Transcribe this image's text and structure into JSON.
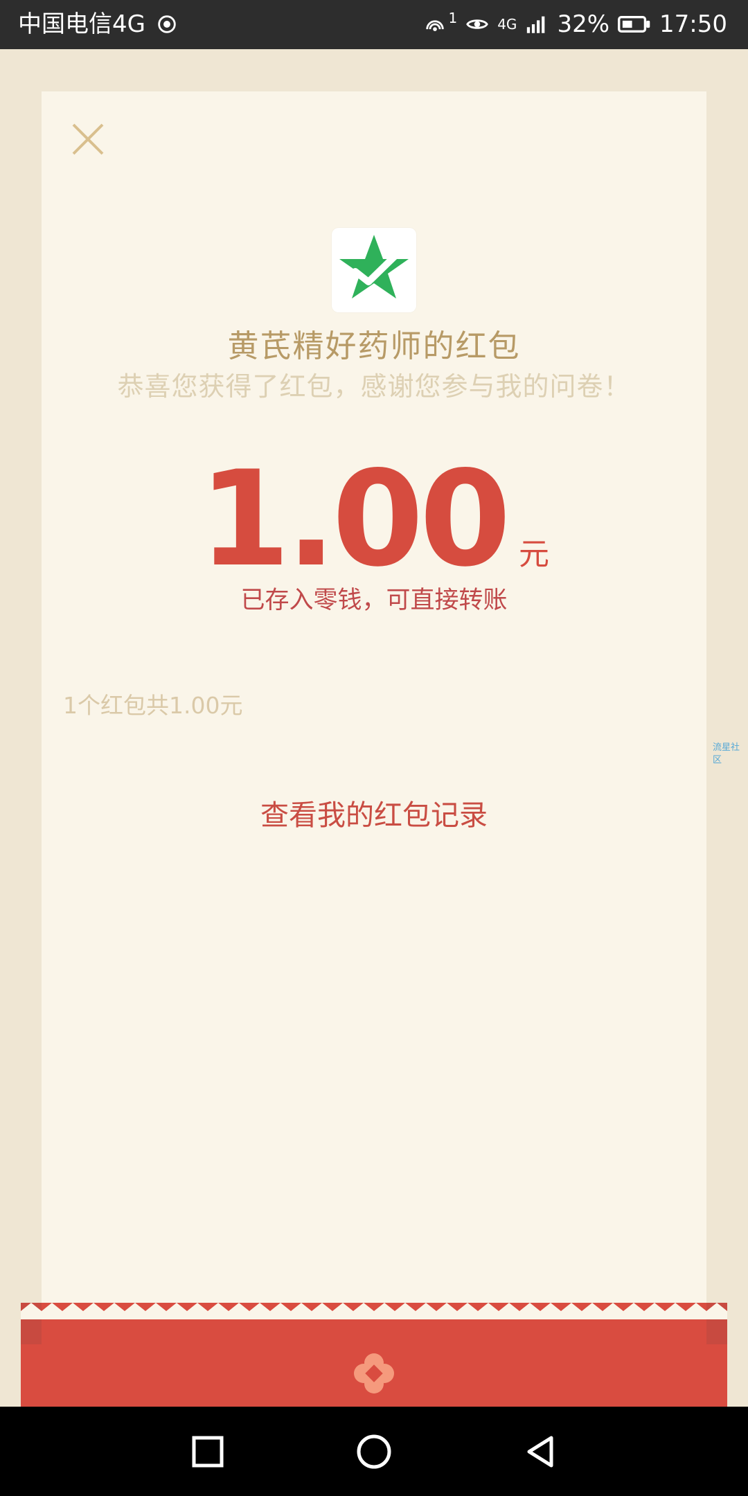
{
  "status_bar": {
    "carrier": "中国电信4G",
    "network_icon": "network-activity-icon",
    "hotspot_badge": "1",
    "signal_label": "4G",
    "battery_text": "32%",
    "time": "17:50"
  },
  "header": {
    "close_icon": "close-icon"
  },
  "redpacket": {
    "sender_title": "黄芪精好药师的红包",
    "message": "恭喜您获得了红包，感谢您参与我的问卷！",
    "amount": "1.00",
    "currency_unit": "元",
    "amount_note": "已存入零钱，可直接转账",
    "summary": "1个红包共1.00元",
    "record_link": "查看我的红包记录",
    "app_icon": "green-star-check-icon"
  },
  "watermark": "流星社区",
  "colors": {
    "status_bar_bg": "#2d2d2d",
    "page_bg": "#efe6d3",
    "sheet_bg": "#faf5e9",
    "title_gold": "#b79a66",
    "message_beige": "#ddd0b3",
    "red": "#d64c3f",
    "summary_beige": "#dac9a8",
    "bottom_red": "#d94c40",
    "nav_bg": "#000000"
  },
  "navigation": {
    "recent_icon": "square-icon",
    "home_icon": "circle-icon",
    "back_icon": "triangle-back-icon"
  }
}
